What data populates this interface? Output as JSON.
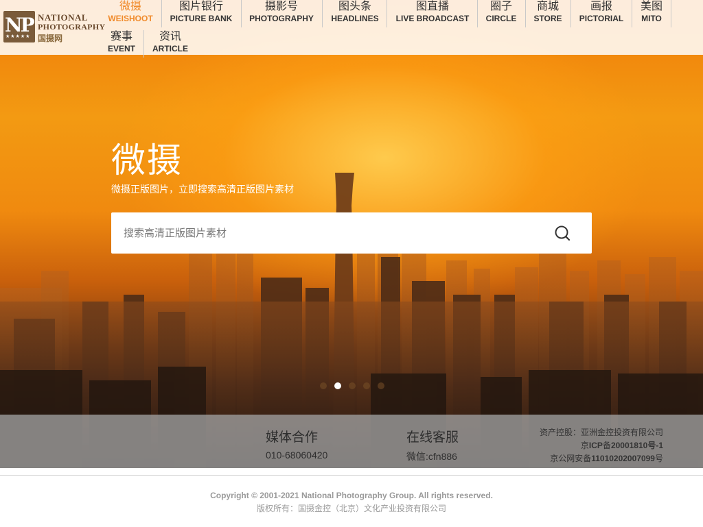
{
  "brand": {
    "logo_mark": "NP",
    "logo_line1": "NATIONAL",
    "logo_line2": "PHOTOGRAPHY",
    "logo_cn": "国摄网",
    "logo_stars": "★★★★★"
  },
  "nav": {
    "items": [
      {
        "cn": "微摄",
        "en": "WEISHOOT",
        "active": true
      },
      {
        "cn": "图片银行",
        "en": "PICTURE BANK"
      },
      {
        "cn": "摄影号",
        "en": "PHOTOGRAPHY"
      },
      {
        "cn": "图头条",
        "en": "HEADLINES"
      },
      {
        "cn": "图直播",
        "en": "LIVE BROADCAST"
      },
      {
        "cn": "圈子",
        "en": "CIRCLE"
      },
      {
        "cn": "商城",
        "en": "STORE"
      },
      {
        "cn": "画报",
        "en": "PICTORIAL"
      },
      {
        "cn": "美图",
        "en": "MITO"
      },
      {
        "cn": "赛事",
        "en": "EVENT"
      },
      {
        "cn": "资讯",
        "en": "ARTICLE"
      }
    ]
  },
  "hero": {
    "title": "微摄",
    "subtitle": "微摄正版图片，立即搜索高清正版图片素材",
    "search_placeholder": "搜索高清正版图片素材",
    "search_icon": "search-icon",
    "slide_count": 5,
    "active_slide": 1
  },
  "info": {
    "media": {
      "title": "媒体合作",
      "value": "010-68060420"
    },
    "service": {
      "title": "在线客服",
      "value": "微信:cfn886"
    },
    "legal": {
      "holding_label": "资产控股：",
      "holding_company": "亚洲金控投资有限公司",
      "icp_prefix": "京",
      "icp_number": "ICP",
      "icp_mid": "备",
      "icp_code": "20001810",
      "icp_suffix": "号-1",
      "police_prefix": "京公网安备",
      "police_code": "11010202007099",
      "police_suffix": "号"
    }
  },
  "footer": {
    "copyright": "Copyright © 2001-2021 National Photography Group. All rights reserved.",
    "owner": "版权所有：国摄金控（北京）文化产业投资有限公司"
  },
  "colors": {
    "accent": "#f08a2a",
    "nav_text": "#333333",
    "sky_top": "#f07a08",
    "sky_bottom": "#2e1c14"
  }
}
